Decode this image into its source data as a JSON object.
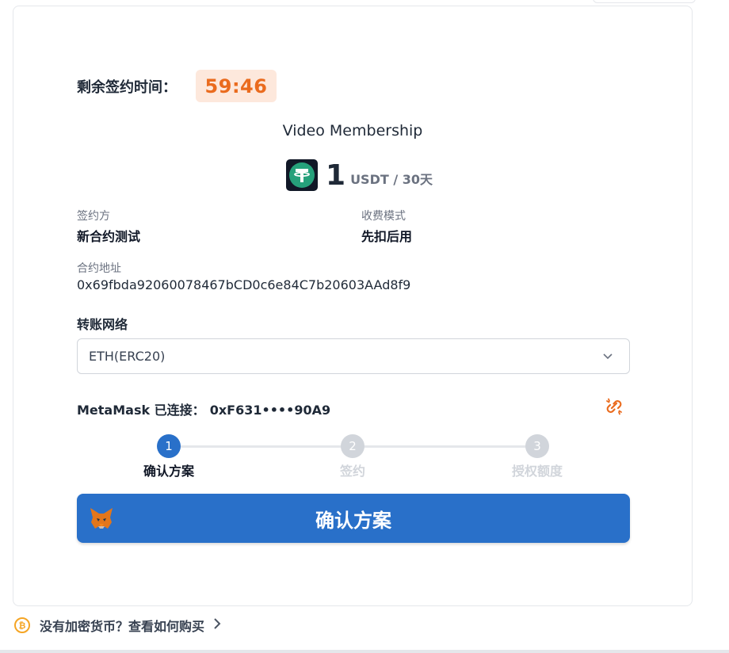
{
  "timer": {
    "label": "剩余签约时间：",
    "value": "59:46"
  },
  "product": {
    "name": "Video Membership",
    "amount": "1",
    "unit": "USDT / 30天"
  },
  "fields": {
    "signer_label": "签约方",
    "signer_value": "新合约测试",
    "billing_label": "收费模式",
    "billing_value": "先扣后用",
    "contract_label": "合约地址",
    "contract_value": "0x69fbda92060078467bCD0c6e84C7b20603AAd8f9"
  },
  "network": {
    "label": "转账网络",
    "selected": "ETH(ERC20)"
  },
  "wallet": {
    "label": "MetaMask 已连接：",
    "address": "0xF631••••90A9"
  },
  "steps": [
    {
      "number": "1",
      "label": "确认方案",
      "active": true
    },
    {
      "number": "2",
      "label": "签约",
      "active": false
    },
    {
      "number": "3",
      "label": "授权额度",
      "active": false
    }
  ],
  "cta": {
    "label": "确认方案"
  },
  "help": {
    "coin_glyph": "₿",
    "text": "没有加密货币？查看如何购买"
  },
  "colors": {
    "accent": "#2970c9",
    "timer": "#ea6b1e",
    "step_inactive": "#d1d5db"
  }
}
